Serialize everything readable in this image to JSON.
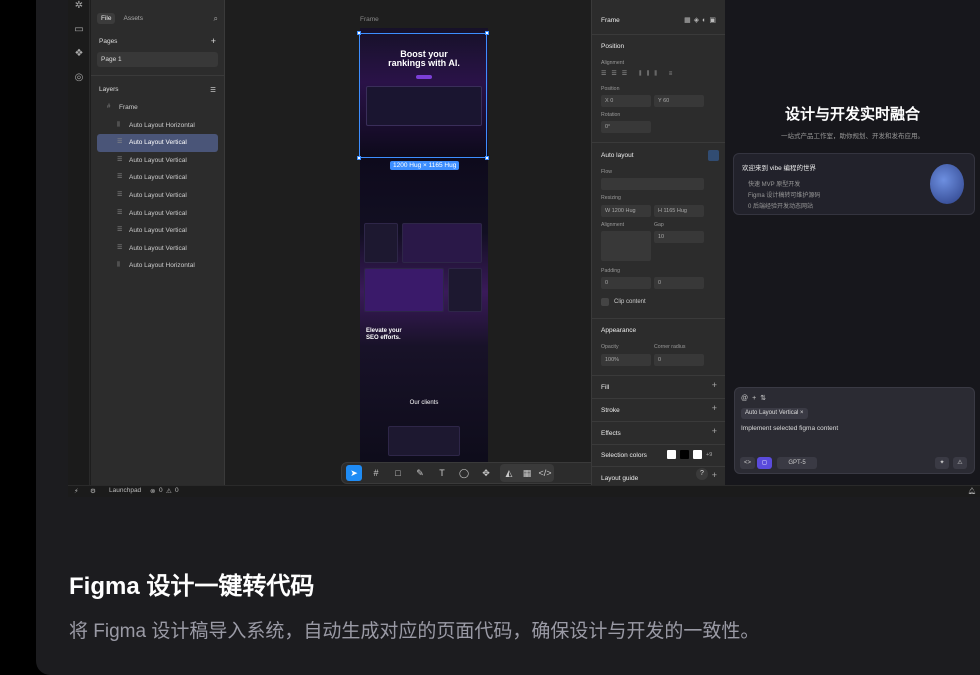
{
  "layers_panel": {
    "tab_file": "File",
    "tab_assets": "Assets",
    "pages_label": "Pages",
    "page_1": "Page 1",
    "layers_label": "Layers",
    "items": [
      {
        "label": "Frame",
        "icon": "frame-icon"
      },
      {
        "label": "Auto Layout Horizontal",
        "icon": "auto-layout-horizontal-icon"
      },
      {
        "label": "Auto Layout Vertical",
        "icon": "auto-layout-vertical-icon"
      },
      {
        "label": "Auto Layout Vertical",
        "icon": "auto-layout-vertical-icon"
      },
      {
        "label": "Auto Layout Vertical",
        "icon": "auto-layout-vertical-icon"
      },
      {
        "label": "Auto Layout Vertical",
        "icon": "auto-layout-vertical-icon"
      },
      {
        "label": "Auto Layout Vertical",
        "icon": "auto-layout-vertical-icon"
      },
      {
        "label": "Auto Layout Vertical",
        "icon": "auto-layout-vertical-icon"
      },
      {
        "label": "Auto Layout Vertical",
        "icon": "auto-layout-vertical-icon"
      },
      {
        "label": "Auto Layout Horizontal",
        "icon": "auto-layout-horizontal-icon"
      }
    ]
  },
  "canvas": {
    "frame_label": "Frame",
    "size_badge": "1200 Hug × 1165 Hug",
    "design": {
      "hero_title_1": "Boost your",
      "hero_title_2": "rankings with AI.",
      "section_title": "Elevate your",
      "section_title_2": "SEO efforts.",
      "clients_title": "Our clients"
    }
  },
  "properties": {
    "frame_label": "Frame",
    "position_title": "Position",
    "alignment_label": "Alignment",
    "position_label": "Position",
    "x_value": "X  0",
    "y_value": "Y  60",
    "rotation_label": "Rotation",
    "rotation_value": "0°",
    "auto_layout_title": "Auto layout",
    "flow_label": "Flow",
    "resizing_label": "Resizing",
    "w_value": "W  1200  Hug",
    "h_value": "H  1165  Hug",
    "alignment2_label": "Alignment",
    "gap_label": "Gap",
    "gap_value": "10",
    "padding_label": "Padding",
    "padding_h": "0",
    "padding_v": "0",
    "clip_content": "Clip content",
    "appearance_title": "Appearance",
    "opacity_label": "Opacity",
    "opacity_value": "100%",
    "corner_radius_label": "Corner radius",
    "corner_radius_value": "0",
    "fill": "Fill",
    "stroke": "Stroke",
    "effects": "Effects",
    "selection_colors": "Selection colors",
    "selection_more": "+9",
    "layout_guide": "Layout guide",
    "help": "?"
  },
  "status_bar": {
    "launchpad": "Launchpad",
    "errors": "0",
    "warnings": "0"
  },
  "right_panel": {
    "title": "设计与开发实时融合",
    "subtitle": "一站式产品工作室，助你规划、开发和发布应用。",
    "welcome_title": "欢迎来到 vibe 编程的世界",
    "welcome_items": [
      "快速 MVP 原型开发",
      "Figma 设计稿转可维护源码",
      "0 后端经验开发动态网站"
    ],
    "chat_chip": "Auto Layout Vertical ×",
    "chat_prompt": "Implement selected figma content",
    "model": "GPT-5"
  },
  "caption": {
    "title": "Figma 设计一键转代码",
    "subtitle": "将 Figma 设计稿导入系统，自动生成对应的页面代码，确保设计与开发的一致性。"
  },
  "colors": {
    "accent": "#3d8eff",
    "purple": "#7b3fd6",
    "selected_layer": "#4a5578"
  }
}
